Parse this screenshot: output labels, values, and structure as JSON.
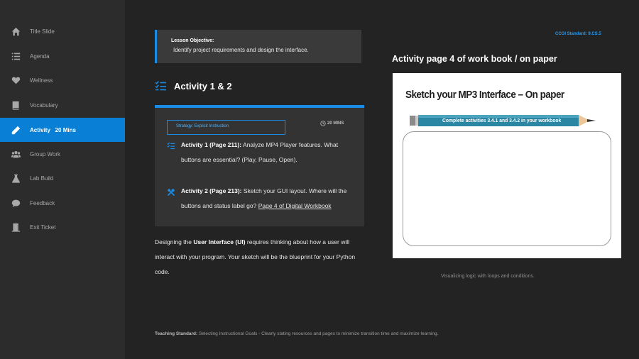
{
  "sidebar": {
    "items": [
      {
        "label": "Title Slide",
        "icon": "home-icon"
      },
      {
        "label": "Agenda",
        "icon": "list-icon"
      },
      {
        "label": "Wellness",
        "icon": "heart-icon"
      },
      {
        "label": "Vocabulary",
        "icon": "book-icon"
      },
      {
        "label": "Activity",
        "badge": "20 Mins",
        "icon": "pencil-icon",
        "active": true
      },
      {
        "label": "Group Work",
        "icon": "group-icon"
      },
      {
        "label": "Lab Build",
        "icon": "flask-icon"
      },
      {
        "label": "Feedback",
        "icon": "chat-icon"
      },
      {
        "label": "Exit Ticket",
        "icon": "door-icon"
      }
    ]
  },
  "objective": {
    "title": "Lesson Objective:",
    "text": "Identify project requirements and design the interface."
  },
  "activity_heading": "Activity 1 & 2",
  "card": {
    "strategy": "Strategy: Explicit Instruction",
    "mins": "20 MINS",
    "activity1": {
      "label": "Activity 1 (Page 211):",
      "text": " Analyze MP4 Player features. What buttons are essential? (Play, Pause, Open)."
    },
    "activity2": {
      "label": "Activity 2 (Page 213):",
      "text": " Sketch your GUI layout. Where will the buttons and status label go? ",
      "link": "Page 4 of Digital Workbook"
    }
  },
  "body": {
    "pre": "Designing the ",
    "bold": "User Interface (UI)",
    "post": " requires thinking about how a user will interact with your program. Your sketch will be the blueprint for your Python code."
  },
  "standard": "CCGI Standard: 9.CS.5",
  "right_title": "Activity page 4 of work book / on paper",
  "sketch": {
    "title": "Sketch your MP3 Interface – On paper",
    "pencil_text": "Complete activities 3.4.1 and 3.4.2 in your workbook"
  },
  "caption": "Visualizing logic with loops and conditions.",
  "footer": {
    "label": "Teaching Standard:",
    "text": " Selecting Instructional Goals - Clearly stating resources and pages to minimize transition time and maximize learning."
  },
  "colors": {
    "accent": "#1b8ce6",
    "active_nav": "#0a7fd6",
    "background": "#232323",
    "sidebar": "#2c2c2c"
  }
}
